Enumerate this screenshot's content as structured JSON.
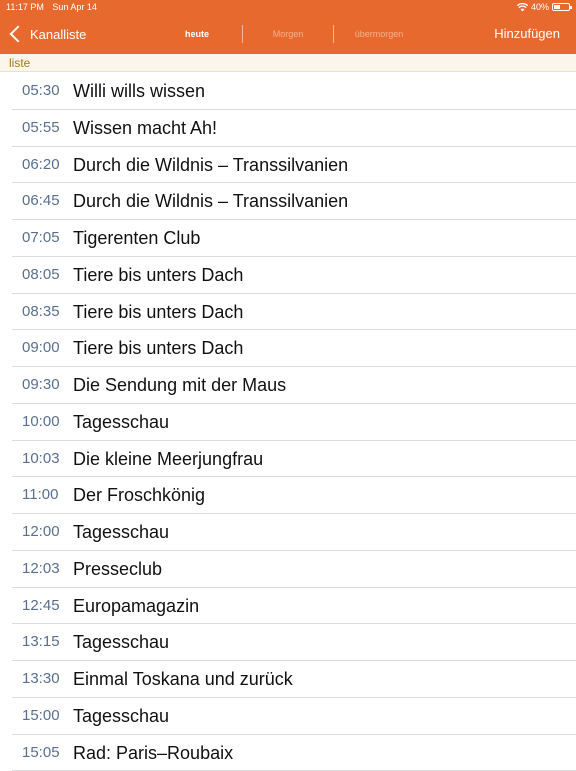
{
  "status": {
    "time": "11:17 PM",
    "date": "Sun Apr 14",
    "battery": "40%",
    "battery_level": 0.4
  },
  "nav": {
    "back_label": "Kanalliste",
    "tabs": [
      {
        "label": "heute",
        "active": true
      },
      {
        "label": "Morgen",
        "active": false
      },
      {
        "label": "übermorgen",
        "active": false
      }
    ],
    "add_label": "Hinzufügen"
  },
  "section": {
    "label": "liste"
  },
  "programs": [
    {
      "time": "05:30",
      "title": "Willi wills wissen"
    },
    {
      "time": "05:55",
      "title": "Wissen macht Ah!"
    },
    {
      "time": "06:20",
      "title": "Durch die Wildnis – Transsilvanien"
    },
    {
      "time": "06:45",
      "title": "Durch die Wildnis – Transsilvanien"
    },
    {
      "time": "07:05",
      "title": "Tigerenten Club"
    },
    {
      "time": "08:05",
      "title": "Tiere bis unters Dach"
    },
    {
      "time": "08:35",
      "title": "Tiere bis unters Dach"
    },
    {
      "time": "09:00",
      "title": "Tiere bis unters Dach"
    },
    {
      "time": "09:30",
      "title": "Die Sendung mit der Maus"
    },
    {
      "time": "10:00",
      "title": "Tagesschau"
    },
    {
      "time": "10:03",
      "title": "Die kleine Meerjungfrau"
    },
    {
      "time": "11:00",
      "title": "Der Froschkönig"
    },
    {
      "time": "12:00",
      "title": "Tagesschau"
    },
    {
      "time": "12:03",
      "title": "Presseclub"
    },
    {
      "time": "12:45",
      "title": "Europamagazin"
    },
    {
      "time": "13:15",
      "title": "Tagesschau"
    },
    {
      "time": "13:30",
      "title": "Einmal Toskana und zurück"
    },
    {
      "time": "15:00",
      "title": "Tagesschau"
    },
    {
      "time": "15:05",
      "title": "Rad: Paris–Roubaix"
    }
  ],
  "colors": {
    "accent": "#e8692e",
    "time_text": "#5a6f8e",
    "section_text": "#a2791f"
  },
  "icons": {
    "back": "chevron-left-icon",
    "wifi": "wifi-icon",
    "battery": "battery-icon"
  }
}
